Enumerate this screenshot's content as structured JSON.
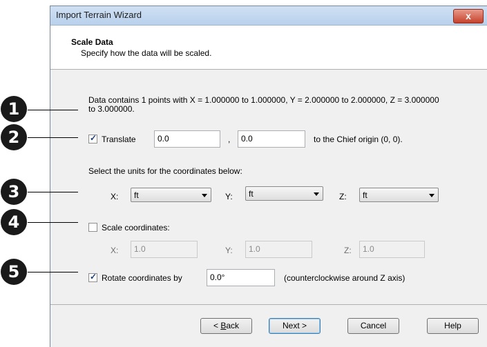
{
  "window": {
    "title": "Import Terrain Wizard",
    "close_label": "x"
  },
  "header": {
    "title": "Scale Data",
    "subtitle": "Specify how the data will be scaled."
  },
  "info_text": "Data contains 1 points with X = 1.000000 to 1.000000, Y = 2.000000 to 2.000000, Z = 3.000000 to 3.000000.",
  "translate": {
    "label": "Translate",
    "checked": true,
    "x_value": "0.0",
    "separator": ",",
    "y_value": "0.0",
    "suffix": "to the Chief origin (0, 0)."
  },
  "units": {
    "prompt": "Select the units for the coordinates below:",
    "x_label": "X:",
    "x_value": "ft",
    "y_label": "Y:",
    "y_value": "ft",
    "z_label": "Z:",
    "z_value": "ft"
  },
  "scale": {
    "label": "Scale coordinates:",
    "checked": false,
    "x_label": "X:",
    "x_value": "1.0",
    "y_label": "Y:",
    "y_value": "1.0",
    "z_label": "Z:",
    "z_value": "1.0"
  },
  "rotate": {
    "label": "Rotate coordinates by",
    "checked": true,
    "value": "0.0°",
    "suffix": "(counterclockwise around Z axis)"
  },
  "buttons": {
    "back_prefix": "< ",
    "back_mnemonic": "B",
    "back_rest": "ack",
    "next": "Next >",
    "cancel": "Cancel",
    "help": "Help"
  },
  "callouts": [
    "1",
    "2",
    "3",
    "4",
    "5"
  ]
}
